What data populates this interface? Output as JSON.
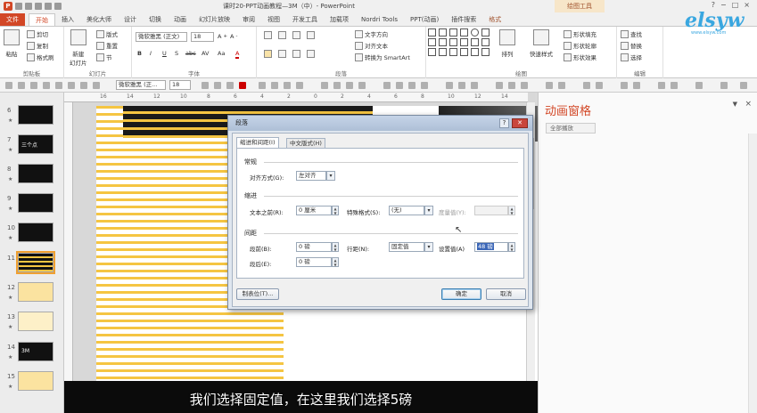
{
  "window": {
    "title": "课时20-PPT动画教程—3M（中）- PowerPoint",
    "contextual_tab_group": "绘图工具",
    "controls": [
      "?",
      "−",
      "□",
      "×"
    ]
  },
  "tabs": [
    "文件",
    "开始",
    "插入",
    "美化大师",
    "设计",
    "切换",
    "动画",
    "幻灯片放映",
    "审阅",
    "视图",
    "开发工具",
    "加载项",
    "Nordri Tools",
    "PPT(动画)",
    "插件搜索",
    "格式"
  ],
  "ribbon": {
    "clipboard": {
      "label": "剪贴板",
      "paste": "粘贴",
      "cut": "剪切",
      "copy": "复制",
      "format_painter": "格式刷"
    },
    "slides": {
      "label": "幻灯片",
      "new_slide": "新建\n幻灯片",
      "layout": "版式",
      "reset": "重置",
      "section": "节"
    },
    "font": {
      "label": "字体",
      "font_name": "微软雅黑 (正文)",
      "font_size": "18",
      "buttons": [
        "B",
        "I",
        "U",
        "S",
        "abc",
        "AV",
        "Aa",
        "A"
      ]
    },
    "paragraph": {
      "label": "段落",
      "text_direction": "文字方向",
      "align_text": "对齐文本",
      "smartart": "转换为 SmartArt"
    },
    "drawing": {
      "label": "绘图",
      "arrange": "排列",
      "quick_styles": "快速样式",
      "shape_fill": "形状填充",
      "shape_outline": "形状轮廓",
      "shape_effects": "形状效果"
    },
    "editing": {
      "label": "编辑",
      "find": "查找",
      "replace": "替换",
      "select": "选择"
    }
  },
  "toolbar2": {
    "font_name": "微软雅黑 (正...",
    "font_size": "18"
  },
  "ruler_ticks": [
    "16",
    "14",
    "12",
    "10",
    "8",
    "6",
    "4",
    "2",
    "0",
    "2",
    "4",
    "6",
    "8",
    "10",
    "12",
    "14"
  ],
  "thumbnails": [
    {
      "num": "6",
      "title": ""
    },
    {
      "num": "7",
      "title": "三个点"
    },
    {
      "num": "8",
      "title": ""
    },
    {
      "num": "9",
      "title": ""
    },
    {
      "num": "10",
      "title": ""
    },
    {
      "num": "11",
      "title": ""
    },
    {
      "num": "12",
      "title": ""
    },
    {
      "num": "13",
      "title": ""
    },
    {
      "num": "14",
      "title": "3M"
    },
    {
      "num": "15",
      "title": ""
    }
  ],
  "anim_pane": {
    "title": "动画窗格",
    "play_all": "全部播放"
  },
  "dialog": {
    "title": "段落",
    "tab_indent": "缩进和间距(I)",
    "tab_chinese": "中文版式(H)",
    "general": {
      "heading": "常规",
      "alignment_label": "对齐方式(G):",
      "alignment_value": "左对齐"
    },
    "indent": {
      "heading": "缩进",
      "before_text_label": "文本之前(R):",
      "before_text_value": "0 厘米",
      "special_label": "特殊格式(S):",
      "special_value": "(无)",
      "by_label": "度量值(Y):",
      "by_value": ""
    },
    "spacing": {
      "heading": "间距",
      "before_label": "段前(B):",
      "before_value": "0 磅",
      "after_label": "段后(E):",
      "after_value": "0 磅",
      "line_label": "行距(N):",
      "line_value": "固定值",
      "at_label": "设置值(A)",
      "at_value": "48 磅"
    },
    "tabs_button": "制表位(T)...",
    "ok": "确定",
    "cancel": "取消"
  },
  "subtitle": "我们选择固定值，在这里我们选择5磅",
  "watermark": {
    "brand": "elsyw",
    "tagline": "www.elsyw.com"
  },
  "colors": {
    "accent": "#d24726",
    "stripe": "#f5c542",
    "selection": "#3c67b8"
  }
}
